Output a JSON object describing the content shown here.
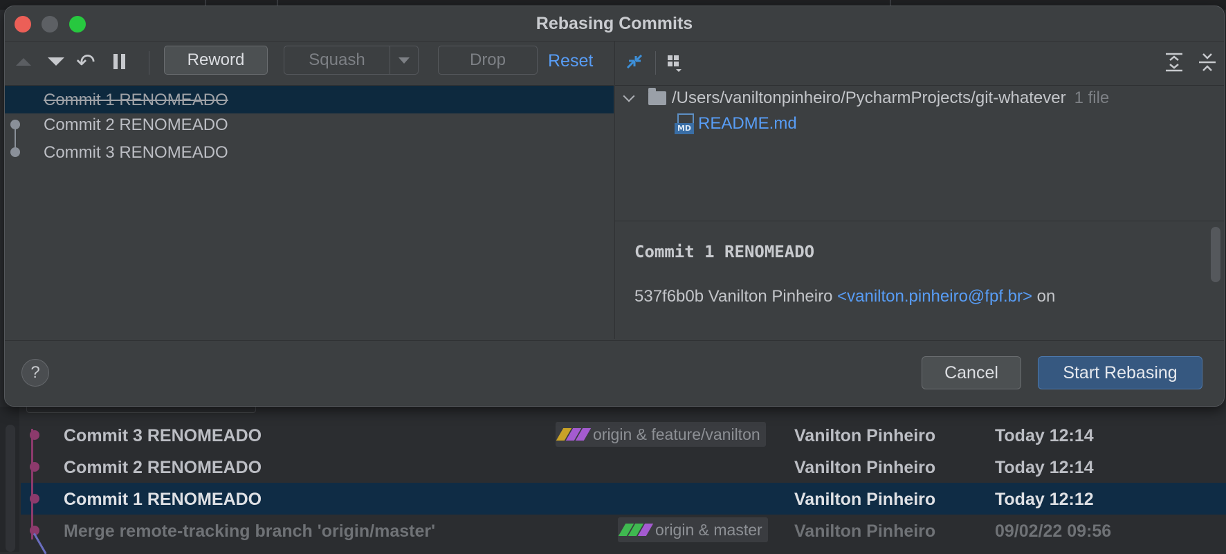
{
  "dialog": {
    "title": "Rebasing Commits",
    "toolbar": {
      "reword_label": "Reword",
      "squash_label": "Squash",
      "drop_label": "Drop",
      "reset_label": "Reset"
    },
    "commits": [
      {
        "label": "Commit 1 RENOMEADO",
        "selected": true,
        "action": "drop"
      },
      {
        "label": "Commit 2 RENOMEADO"
      },
      {
        "label": "Commit 3 RENOMEADO"
      }
    ],
    "changes": {
      "root_path": "/Users/vaniltonpinheiro/PycharmProjects/git-whatever",
      "file_count": "1 file",
      "files": [
        {
          "name": "README.md",
          "icon": "markdown-file-icon"
        }
      ]
    },
    "details": {
      "title": "Commit 1 RENOMEADO",
      "hash": "537f6b0b",
      "author": "Vanilton Pinheiro",
      "email": "<vanilton.pinheiro@fpf.br>",
      "suffix": "on"
    },
    "footer": {
      "help_label": "?",
      "cancel_label": "Cancel",
      "start_label": "Start Rebasing"
    },
    "accent_color": "#589df6"
  },
  "log": {
    "rows": [
      {
        "message": "Commit 3 RENOMEADO",
        "refs": "origin & feature/vanilton",
        "author": "Vanilton Pinheiro",
        "date": "Today 12:14"
      },
      {
        "message": "Commit 2 RENOMEADO",
        "refs": "",
        "author": "Vanilton Pinheiro",
        "date": "Today 12:14"
      },
      {
        "message": "Commit 1 RENOMEADO",
        "refs": "",
        "author": "Vanilton Pinheiro",
        "date": "Today 12:12",
        "selected": true
      },
      {
        "message": "Merge remote-tracking branch 'origin/master'",
        "refs": "origin & master",
        "author": "Vanilton Pinheiro",
        "date": "09/02/22 09:56",
        "dimmed": true
      }
    ]
  }
}
